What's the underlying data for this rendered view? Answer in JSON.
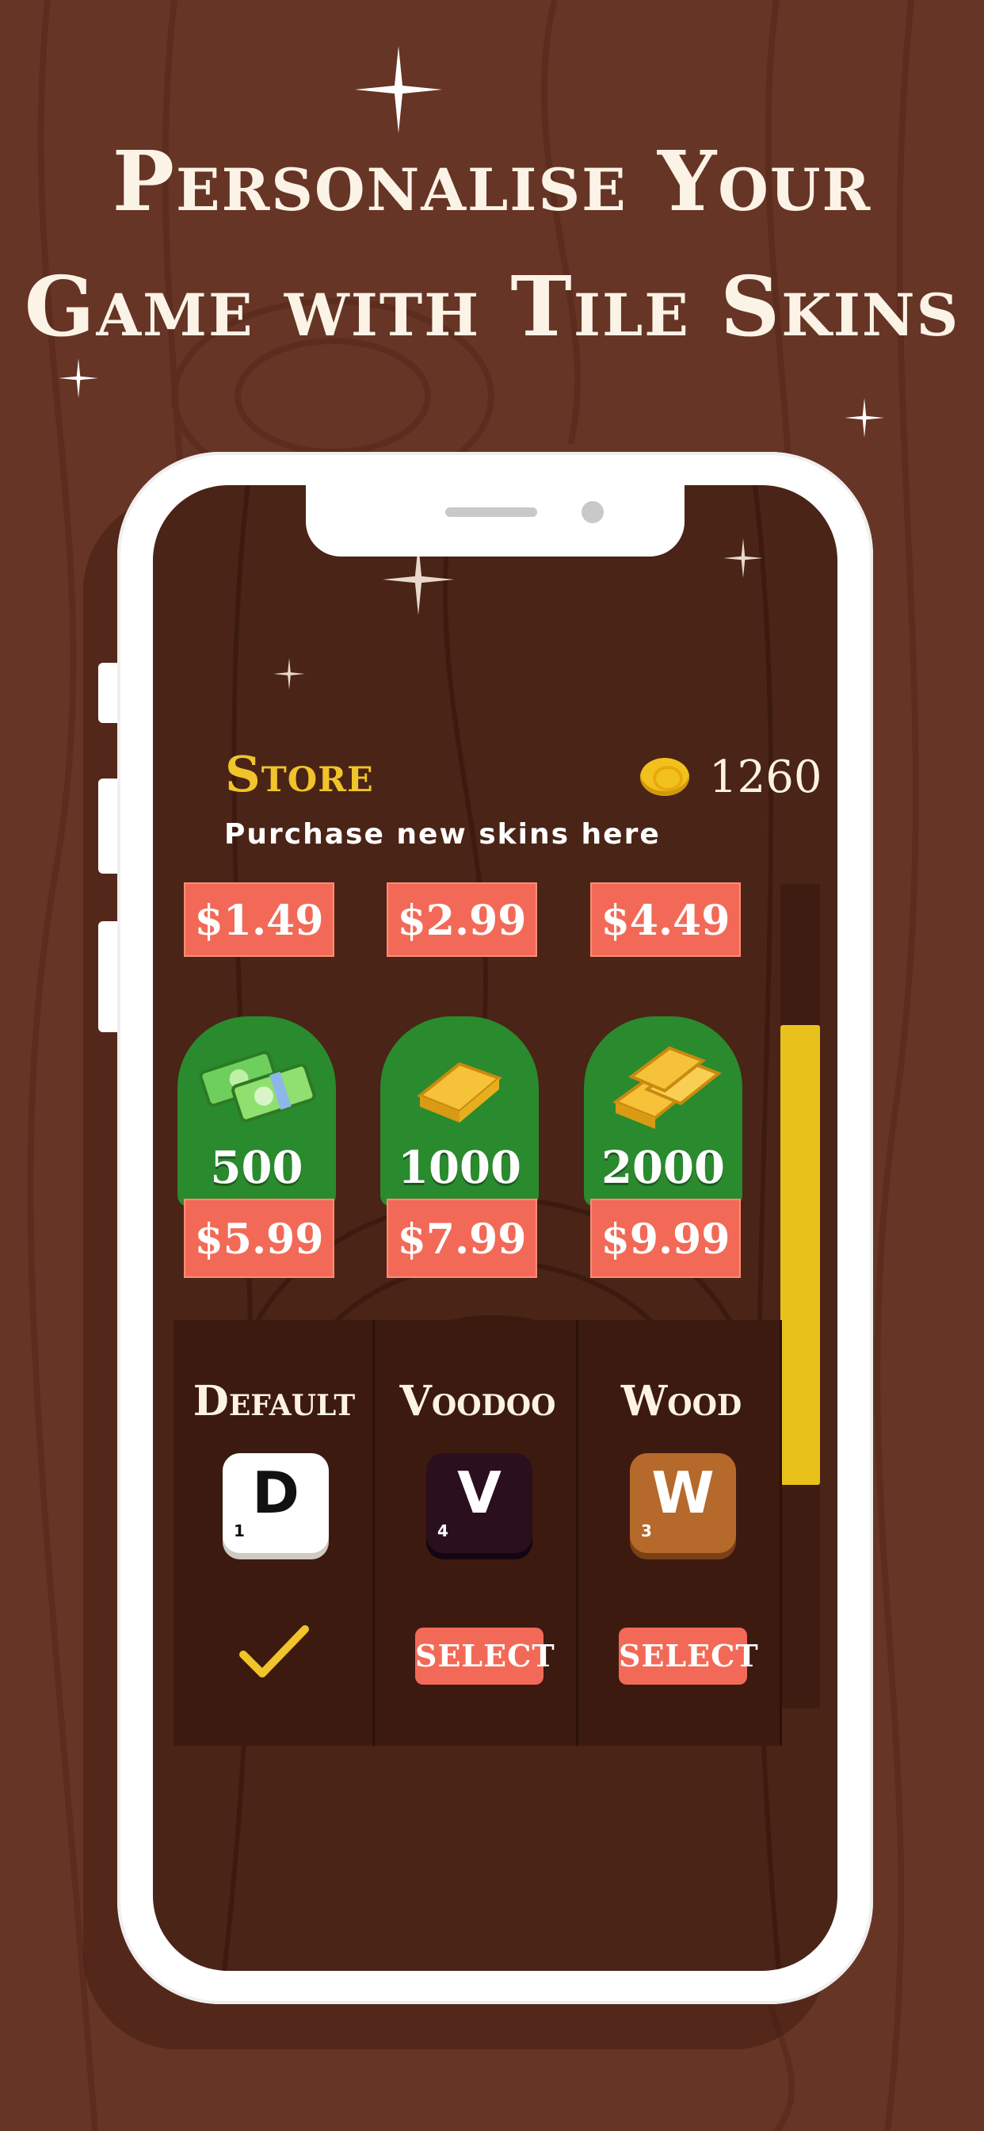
{
  "headline": {
    "line1": "Personalise Your",
    "line2": "Game with Tile Skins"
  },
  "store": {
    "title": "Store",
    "subtitle": "Purchase new skins here",
    "coin_balance": "1260",
    "price_row_top": [
      "$1.49",
      "$2.99",
      "$4.49"
    ],
    "coin_packs": [
      {
        "amount": "500",
        "price": "$5.99",
        "icon": "cash-stack-icon"
      },
      {
        "amount": "1000",
        "price": "$7.99",
        "icon": "gold-bar-icon"
      },
      {
        "amount": "2000",
        "price": "$9.99",
        "icon": "gold-bars-icon"
      }
    ]
  },
  "skins": [
    {
      "name": "Default",
      "letter": "D",
      "number": "1",
      "state": "selected"
    },
    {
      "name": "Voodoo",
      "letter": "V",
      "number": "4",
      "action": "SELECT"
    },
    {
      "name": "Wood",
      "letter": "W",
      "number": "3",
      "action": "SELECT"
    }
  ],
  "colors": {
    "background": "#663525",
    "screen": "#4a2416",
    "accent_gold": "#f0c42a",
    "button_red": "#f26a57",
    "pack_green": "#2a8a2e"
  }
}
